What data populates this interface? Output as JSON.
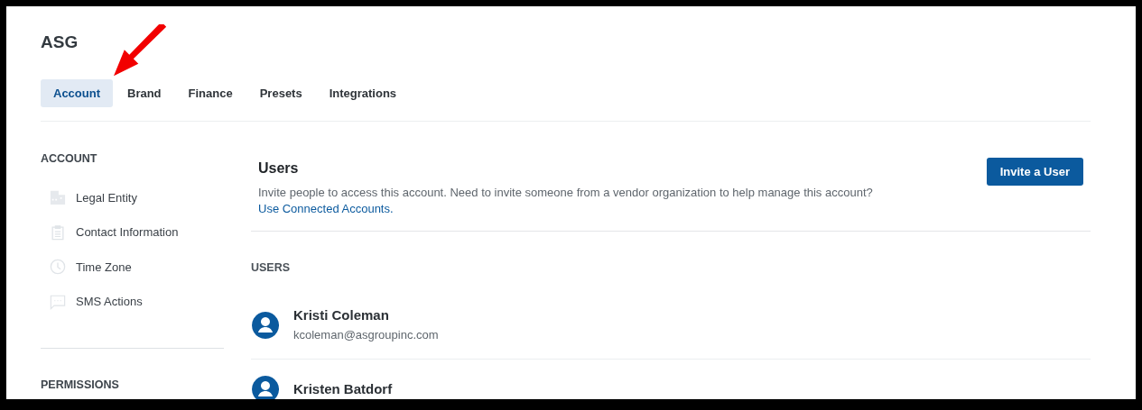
{
  "header": {
    "title": "ASG"
  },
  "tabs": [
    {
      "label": "Account",
      "selected": true
    },
    {
      "label": "Brand",
      "selected": false
    },
    {
      "label": "Finance",
      "selected": false
    },
    {
      "label": "Presets",
      "selected": false
    },
    {
      "label": "Integrations",
      "selected": false
    }
  ],
  "sidebar": {
    "sections": [
      {
        "heading": "ACCOUNT",
        "items": [
          {
            "label": "Legal Entity",
            "kind": "building"
          },
          {
            "label": "Contact Information",
            "kind": "clipboard"
          },
          {
            "label": "Time Zone",
            "kind": "clock"
          },
          {
            "label": "SMS Actions",
            "kind": "chat"
          }
        ]
      },
      {
        "heading": "PERMISSIONS"
      }
    ]
  },
  "main": {
    "title": "Users",
    "description": "Invite people to access this account. Need to invite someone from a vendor organization to help manage this account?",
    "link": "Use Connected Accounts.",
    "button": "Invite a User",
    "list_heading": "USERS",
    "users": [
      {
        "name": "Kristi Coleman",
        "email": "kcoleman@asgroupinc.com"
      },
      {
        "name": "Kristen Batdorf"
      }
    ]
  }
}
